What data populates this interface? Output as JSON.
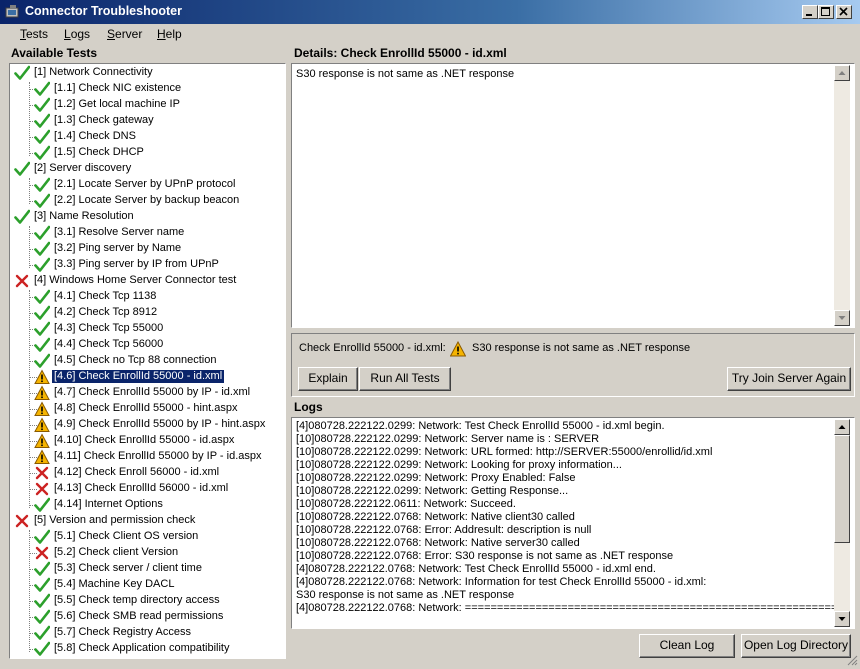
{
  "window": {
    "title": "Connector Troubleshooter"
  },
  "menu": [
    "Tests",
    "Logs",
    "Server",
    "Help"
  ],
  "tests_panel": {
    "label": "Available Tests"
  },
  "tests": [
    {
      "label": "[1] Network Connectivity",
      "status": "pass",
      "level": 0
    },
    {
      "label": "[1.1] Check NIC existence",
      "status": "pass",
      "level": 1
    },
    {
      "label": "[1.2] Get local machine IP",
      "status": "pass",
      "level": 1
    },
    {
      "label": "[1.3] Check gateway",
      "status": "pass",
      "level": 1
    },
    {
      "label": "[1.4] Check DNS",
      "status": "pass",
      "level": 1
    },
    {
      "label": "[1.5] Check DHCP",
      "status": "pass",
      "level": 1
    },
    {
      "label": "[2] Server discovery",
      "status": "pass",
      "level": 0
    },
    {
      "label": "[2.1] Locate Server by UPnP protocol",
      "status": "pass",
      "level": 1
    },
    {
      "label": "[2.2] Locate Server by backup beacon",
      "status": "pass",
      "level": 1
    },
    {
      "label": "[3] Name Resolution",
      "status": "pass",
      "level": 0
    },
    {
      "label": "[3.1] Resolve Server name",
      "status": "pass",
      "level": 1
    },
    {
      "label": "[3.2] Ping server by Name",
      "status": "pass",
      "level": 1
    },
    {
      "label": "[3.3] Ping server by IP from UPnP",
      "status": "pass",
      "level": 1
    },
    {
      "label": "[4] Windows Home Server Connector test",
      "status": "fail",
      "level": 0
    },
    {
      "label": "[4.1] Check Tcp 1138",
      "status": "pass",
      "level": 1
    },
    {
      "label": "[4.2] Check Tcp 8912",
      "status": "pass",
      "level": 1
    },
    {
      "label": "[4.3] Check Tcp 55000",
      "status": "pass",
      "level": 1
    },
    {
      "label": "[4.4] Check Tcp 56000",
      "status": "pass",
      "level": 1
    },
    {
      "label": "[4.5] Check no Tcp 88 connection",
      "status": "pass",
      "level": 1
    },
    {
      "label": "[4.6] Check EnrollId 55000 - id.xml",
      "status": "warn",
      "level": 1,
      "selected": true
    },
    {
      "label": "[4.7] Check EnrollId 55000 by IP - id.xml",
      "status": "warn",
      "level": 1
    },
    {
      "label": "[4.8] Check EnrollId 55000 - hint.aspx",
      "status": "warn",
      "level": 1
    },
    {
      "label": "[4.9] Check EnrollId 55000 by IP - hint.aspx",
      "status": "warn",
      "level": 1
    },
    {
      "label": "[4.10] Check EnrollId 55000 - id.aspx",
      "status": "warn",
      "level": 1
    },
    {
      "label": "[4.11] Check EnrollId 55000 by IP - id.aspx",
      "status": "warn",
      "level": 1
    },
    {
      "label": "[4.12] Check Enroll 56000 - id.xml",
      "status": "fail",
      "level": 1
    },
    {
      "label": "[4.13] Check EnrollId 56000 - id.xml",
      "status": "fail",
      "level": 1
    },
    {
      "label": "[4.14] Internet Options",
      "status": "pass",
      "level": 1
    },
    {
      "label": "[5] Version and permission check",
      "status": "fail",
      "level": 0
    },
    {
      "label": "[5.1] Check Client OS version",
      "status": "pass",
      "level": 1
    },
    {
      "label": "[5.2] Check client Version",
      "status": "fail",
      "level": 1
    },
    {
      "label": "[5.3] Check server / client time",
      "status": "pass",
      "level": 1
    },
    {
      "label": "[5.4] Machine Key DACL",
      "status": "pass",
      "level": 1
    },
    {
      "label": "[5.5] Check temp directory access",
      "status": "pass",
      "level": 1
    },
    {
      "label": "[5.6] Check SMB read permissions",
      "status": "pass",
      "level": 1
    },
    {
      "label": "[5.7] Check Registry Access",
      "status": "pass",
      "level": 1
    },
    {
      "label": "[5.8] Check Application compatibility",
      "status": "pass",
      "level": 1
    }
  ],
  "details": {
    "label": "Details: Check EnrollId 55000 - id.xml",
    "text": "S30 response is not same as .NET response"
  },
  "summary": {
    "test_name": "Check EnrollId 55000 - id.xml:",
    "message": "S30 response is not same as .NET response"
  },
  "buttons": {
    "explain": "Explain",
    "run_all": "Run All Tests",
    "try_join": "Try Join Server Again",
    "clean_log": "Clean Log",
    "open_log_dir": "Open Log Directory"
  },
  "logs": {
    "label": "Logs",
    "lines": [
      "[4]080728.222122.0299: Network: Test Check EnrollId 55000 - id.xml begin.",
      "[10]080728.222122.0299: Network: Server name is : SERVER",
      "[10]080728.222122.0299: Network: URL formed: http://SERVER:55000/enrollid/id.xml",
      "[10]080728.222122.0299: Network: Looking for proxy information...",
      "[10]080728.222122.0299: Network: Proxy Enabled: False",
      "[10]080728.222122.0299: Network: Getting Response...",
      "[10]080728.222122.0611: Network: Succeed.",
      "[10]080728.222122.0768: Network: Native client30 called",
      "[10]080728.222122.0768: Error: Addresult: description is null",
      "[10]080728.222122.0768: Network: Native server30 called",
      "[10]080728.222122.0768: Error: S30 response is not same as .NET response",
      "[4]080728.222122.0768: Network: Test Check EnrollId 55000 - id.xml end.",
      "[4]080728.222122.0768: Network: Information for test Check EnrollId 55000 - id.xml:",
      " S30 response is not same as .NET response",
      "[4]080728.222122.0768: Network: ==========================================================="
    ]
  },
  "colors": {
    "pass": "#2ca02c",
    "fail": "#cc2222",
    "warn": "#e8a200",
    "title_bar": "#0a246a",
    "selection": "#0a246a"
  }
}
